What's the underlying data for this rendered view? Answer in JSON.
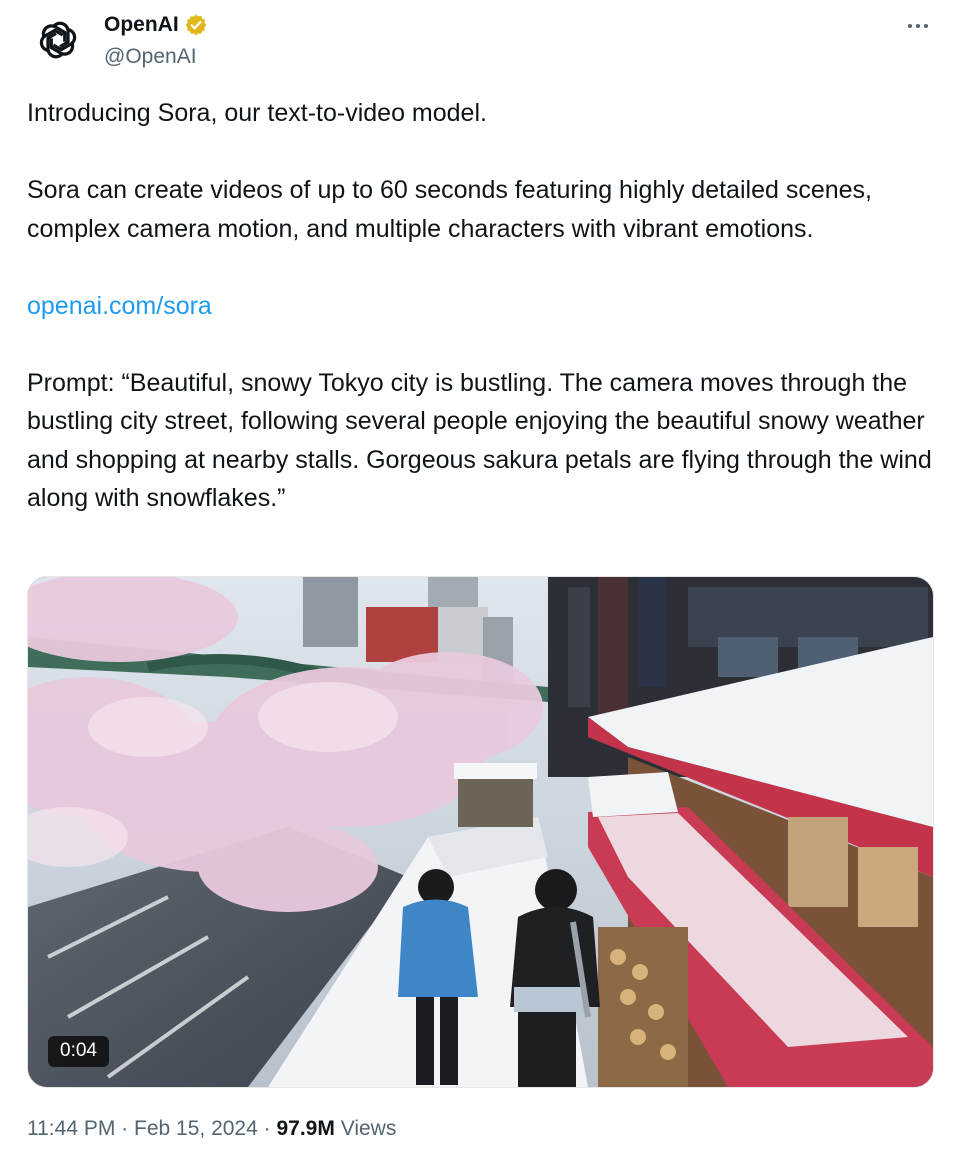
{
  "author": {
    "display_name": "OpenAI",
    "handle": "@OpenAI",
    "verified": true,
    "verified_color": "#e2b719",
    "avatar_icon": "openai-logo-icon"
  },
  "more_icon": "more-horizontal-icon",
  "tweet": {
    "line1": "Introducing Sora, our text-to-video model.",
    "line2": "Sora can create videos of up to 60 seconds featuring highly detailed scenes, complex camera motion, and multiple characters with vibrant emotions.",
    "link_text": "openai.com/sora",
    "prompt": "Prompt: “Beautiful, snowy Tokyo city is bustling. The camera moves through the bustling city street, following several people enjoying the beautiful snowy weather and shopping at nearby stalls. Gorgeous sakura petals are flying through the wind along with snowflakes.”"
  },
  "media": {
    "type": "video",
    "duration": "0:04"
  },
  "meta": {
    "time": "11:44 PM",
    "separator": "·",
    "date": "Feb 15, 2024",
    "views_count": "97.9M",
    "views_label": "Views"
  },
  "colors": {
    "link": "#1d9bf0",
    "secondary_text": "#536471",
    "primary_text": "#0f1419"
  }
}
